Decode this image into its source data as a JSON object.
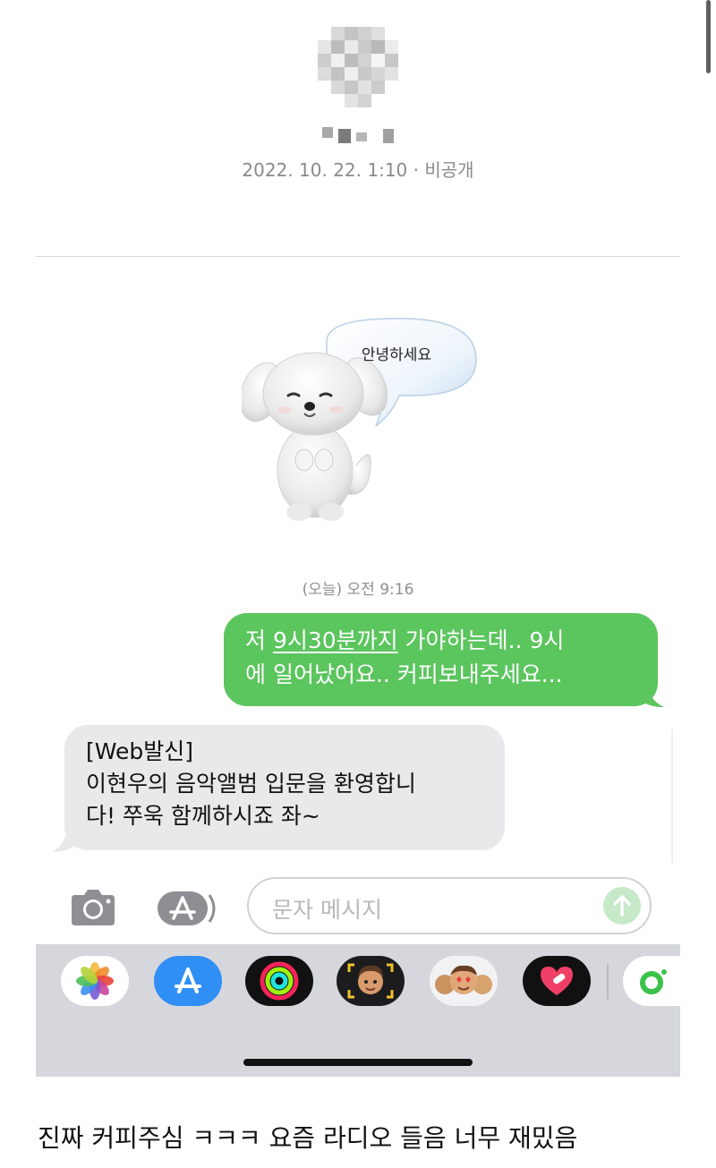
{
  "header": {
    "date_line": "2022. 10. 22. 1:10 · 비공개"
  },
  "sticker": {
    "speech_text": "안녕하세요"
  },
  "thread": {
    "timestamp": "(오늘) 오전 9:16",
    "outgoing": {
      "pre": "저 ",
      "link": "9시30분까지",
      "mid": " 가야하는데.. 9시",
      "line2": "에 일어났어요.. 커피보내주세요..."
    },
    "incoming": {
      "line1": "[Web발신]",
      "line2": "이현우의 음악앨범 입문을 환영합니",
      "line3": "다! 쭈욱 함께하시죠 좌~"
    }
  },
  "composer": {
    "placeholder": "문자 메시지",
    "camera_icon": "camera-icon",
    "apps_icon": "app-store-icon",
    "send_icon": "arrow-up-icon"
  },
  "app_drawer": {
    "apps": [
      "photos-icon",
      "app-store-icon",
      "activity-icon",
      "memoji-camera-icon",
      "memoji-stickers-icon",
      "heart-icon",
      "music-icon"
    ]
  },
  "caption": "진짜 커피주심 ㅋㅋㅋ 요즘 라디오 들음 너무 재밌음",
  "colors": {
    "outgoing_bubble": "#5bc55e",
    "incoming_bubble": "#e9e9eb",
    "drawer_bg": "#d6d7dc"
  }
}
